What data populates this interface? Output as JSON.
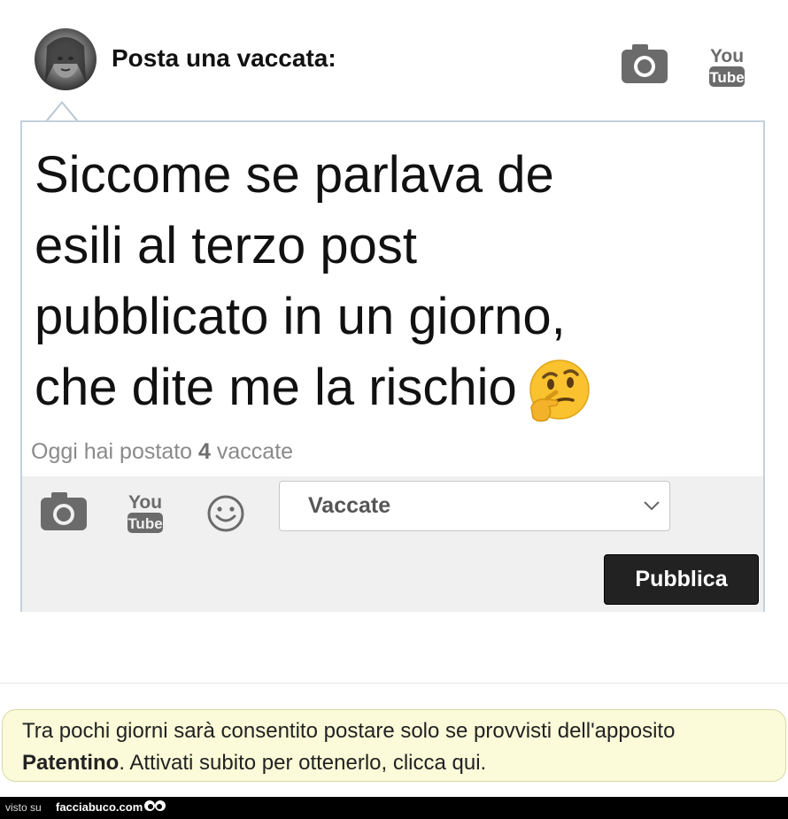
{
  "header": {
    "title": "Posta una vaccata:",
    "avatar_icon": "user-avatar",
    "camera_icon": "camera-icon",
    "youtube_icon": "youtube-icon"
  },
  "post": {
    "lines": [
      "Siccome se parlava de",
      "esili al terzo post",
      "pubblicato in un giorno,",
      "che dite me la rischio"
    ],
    "emoji": "thinking-face-emoji"
  },
  "counter": {
    "prefix": "Oggi hai postato",
    "count": "4",
    "suffix": "vaccate"
  },
  "toolbar": {
    "category_select": "Vaccate",
    "publish_label": "Pubblica"
  },
  "notice": {
    "part1": "Tra pochi giorni sarà consentito postare solo se provvisti dell'apposito",
    "bold": "Patentino",
    "part2": ". Attivati subito per ottenerlo, clicca qui."
  },
  "footer": {
    "visto": "visto su",
    "site": "facciabuco.com"
  },
  "colors": {
    "border": "#c4d0dc",
    "toolbar_bg": "#f0f0f0",
    "publish_bg": "#222222",
    "notice_bg": "#fbfbd9"
  }
}
